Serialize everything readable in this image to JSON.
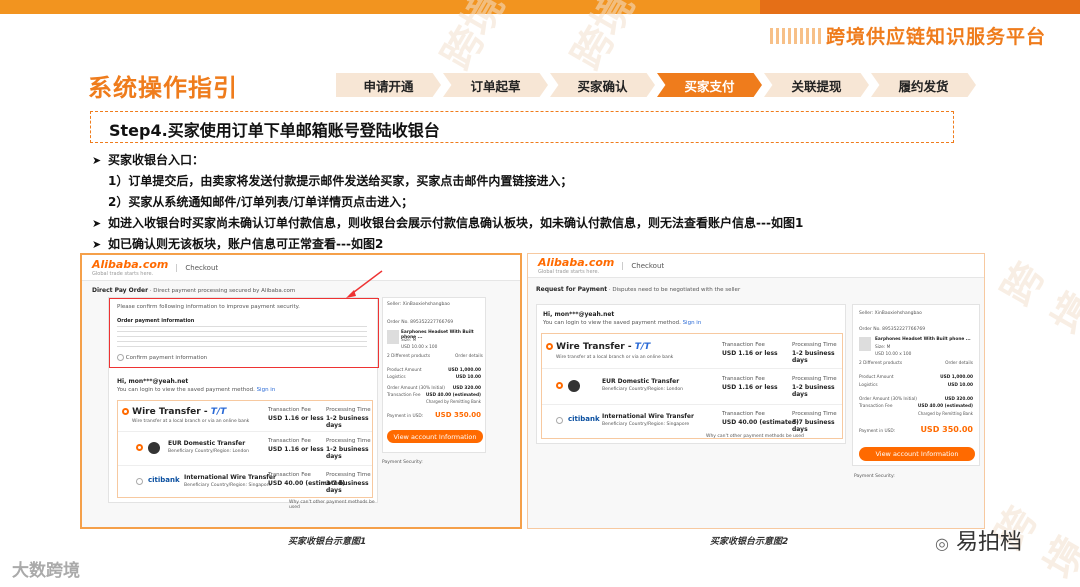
{
  "header": {
    "platform_title": "跨境供应链知识服务平台",
    "section_title": "系统操作指引"
  },
  "tabs": [
    {
      "label": "申请开通",
      "active": false
    },
    {
      "label": "订单起草",
      "active": false
    },
    {
      "label": "买家确认",
      "active": false
    },
    {
      "label": "买家支付",
      "active": true
    },
    {
      "label": "关联提现",
      "active": false
    },
    {
      "label": "履约发货",
      "active": false
    }
  ],
  "step": {
    "title": "Step4.买家使用订单下单邮箱账号登陆收银台"
  },
  "bullets": {
    "b1": "买家收银台入口：",
    "b1a": "1）订单提交后，由卖家将发送付款提示邮件发送给买家，买家点击邮件内置链接进入；",
    "b1b": "2）买家从系统通知邮件/订单列表/订单详情页点击进入；",
    "b2": "如进入收银台时买家尚未确认订单付款信息，则收银台会展示付款信息确认板块，如未确认付款信息，则无法查看账户信息---如图1",
    "b3": "如已确认则无该板块，账户信息可正常查看---如图2"
  },
  "shot": {
    "logo": "Alibaba.com",
    "logo_sub": "Global trade starts here.",
    "checkout": "Checkout",
    "s1_header": "Direct Pay Order",
    "s1_header_sub": "· Direct payment processing secured by Alibaba.com",
    "s2_header": "Request for Payment",
    "s2_header_sub": "· Disputes need to be negotiated with the seller",
    "confirm_notice": "Please confirm following information to improve payment security.",
    "order_payment_info": "Order payment information",
    "confirm_label": "Confirm payment information",
    "hi_user": "Hi, mon***@yeah.net",
    "login_hint": "You can login to view the saved payment method.",
    "sign_in": "Sign in",
    "wire_title": "Wire Transfer - ",
    "wire_tt": "T/T",
    "wire_sub": "Wire transfer at a local branch or via an online bank",
    "fee_label": "Transaction Fee",
    "fee_value": "USD 1.16 or less",
    "time_label": "Processing Time",
    "time_value": "1-2 business days",
    "eur_title": "EUR Domestic Transfer",
    "eur_sub": "Beneficiary Country/Region: London",
    "eur_fee": "USD 1.16 or less",
    "eur_time": "1-2 business days",
    "intl_title": "International Wire Transfer",
    "intl_sub": "Beneficiary Country/Region: Singapore",
    "intl_fee": "USD 40.00 (estimated)",
    "intl_time": "3-7 business days",
    "citibank": "citibank",
    "other_methods": "Why can't other payment methods be used",
    "seller_label": "Seller:",
    "seller_name": "XinBaoxiehshangbao",
    "order_no": "Order No. 895352227766769",
    "product": "Earphones Headset With Built phone ...",
    "product_size": "Size: M",
    "product_price": "USD 10.00 x 100",
    "diff_products": "2 Different products",
    "order_details": "Order details",
    "product_amount_label": "Product Amount",
    "product_amount": "USD 1,000.00",
    "logistics_label": "Logistics",
    "logistics": "USD 10.00",
    "order_amount_label": "Order Amount (30% Initial)",
    "order_amount": "USD 320.00",
    "tx_fee_label": "Transaction Fee",
    "tx_fee": "USD 40.00 (estimated)",
    "charged_by": "Charged by Remitting Bank",
    "payment_label": "Payment in USD:",
    "payment_value": "USD 350.00",
    "view_btn": "View account Information",
    "security": "Payment Security:"
  },
  "captions": {
    "c1": "买家收银台示意图1",
    "c2": "买家收银台示意图2"
  },
  "footer": {
    "left_logo": "大数跨境",
    "wechat": "易拍档"
  },
  "colors": {
    "accent": "#ef7c1c",
    "ali_orange": "#ff6a00",
    "tab_bg": "#f7e6d5"
  }
}
